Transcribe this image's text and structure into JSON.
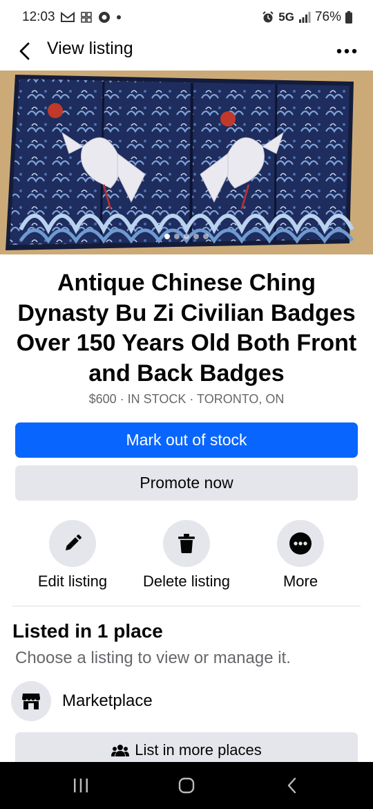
{
  "status_bar": {
    "time": "12:03",
    "network": "5G",
    "battery": "76%"
  },
  "app_bar": {
    "title": "View listing"
  },
  "hero": {
    "image_count": 5,
    "active_index": 0
  },
  "listing": {
    "title": "Antique Chinese Ching Dynasty Bu Zi Civilian Badges Over 150 Years Old Both Front and Back Badges",
    "meta": "$600 · IN STOCK · TORONTO, ON"
  },
  "buttons": {
    "mark_out_of_stock": "Mark out of stock",
    "promote_now": "Promote now",
    "list_in_more_places": "List in more places"
  },
  "actions": [
    {
      "label": "Edit listing",
      "icon": "pencil-icon"
    },
    {
      "label": "Delete listing",
      "icon": "trash-icon"
    },
    {
      "label": "More",
      "icon": "more-dots-icon"
    }
  ],
  "listed": {
    "title": "Listed in 1 place",
    "subtitle": "Choose a listing to view or manage it.",
    "places": [
      {
        "label": "Marketplace",
        "icon": "marketplace-store-icon"
      }
    ]
  },
  "colors": {
    "primary": "#0866ff",
    "secondary_bg": "#e4e6eb",
    "muted_text": "#65676b"
  }
}
